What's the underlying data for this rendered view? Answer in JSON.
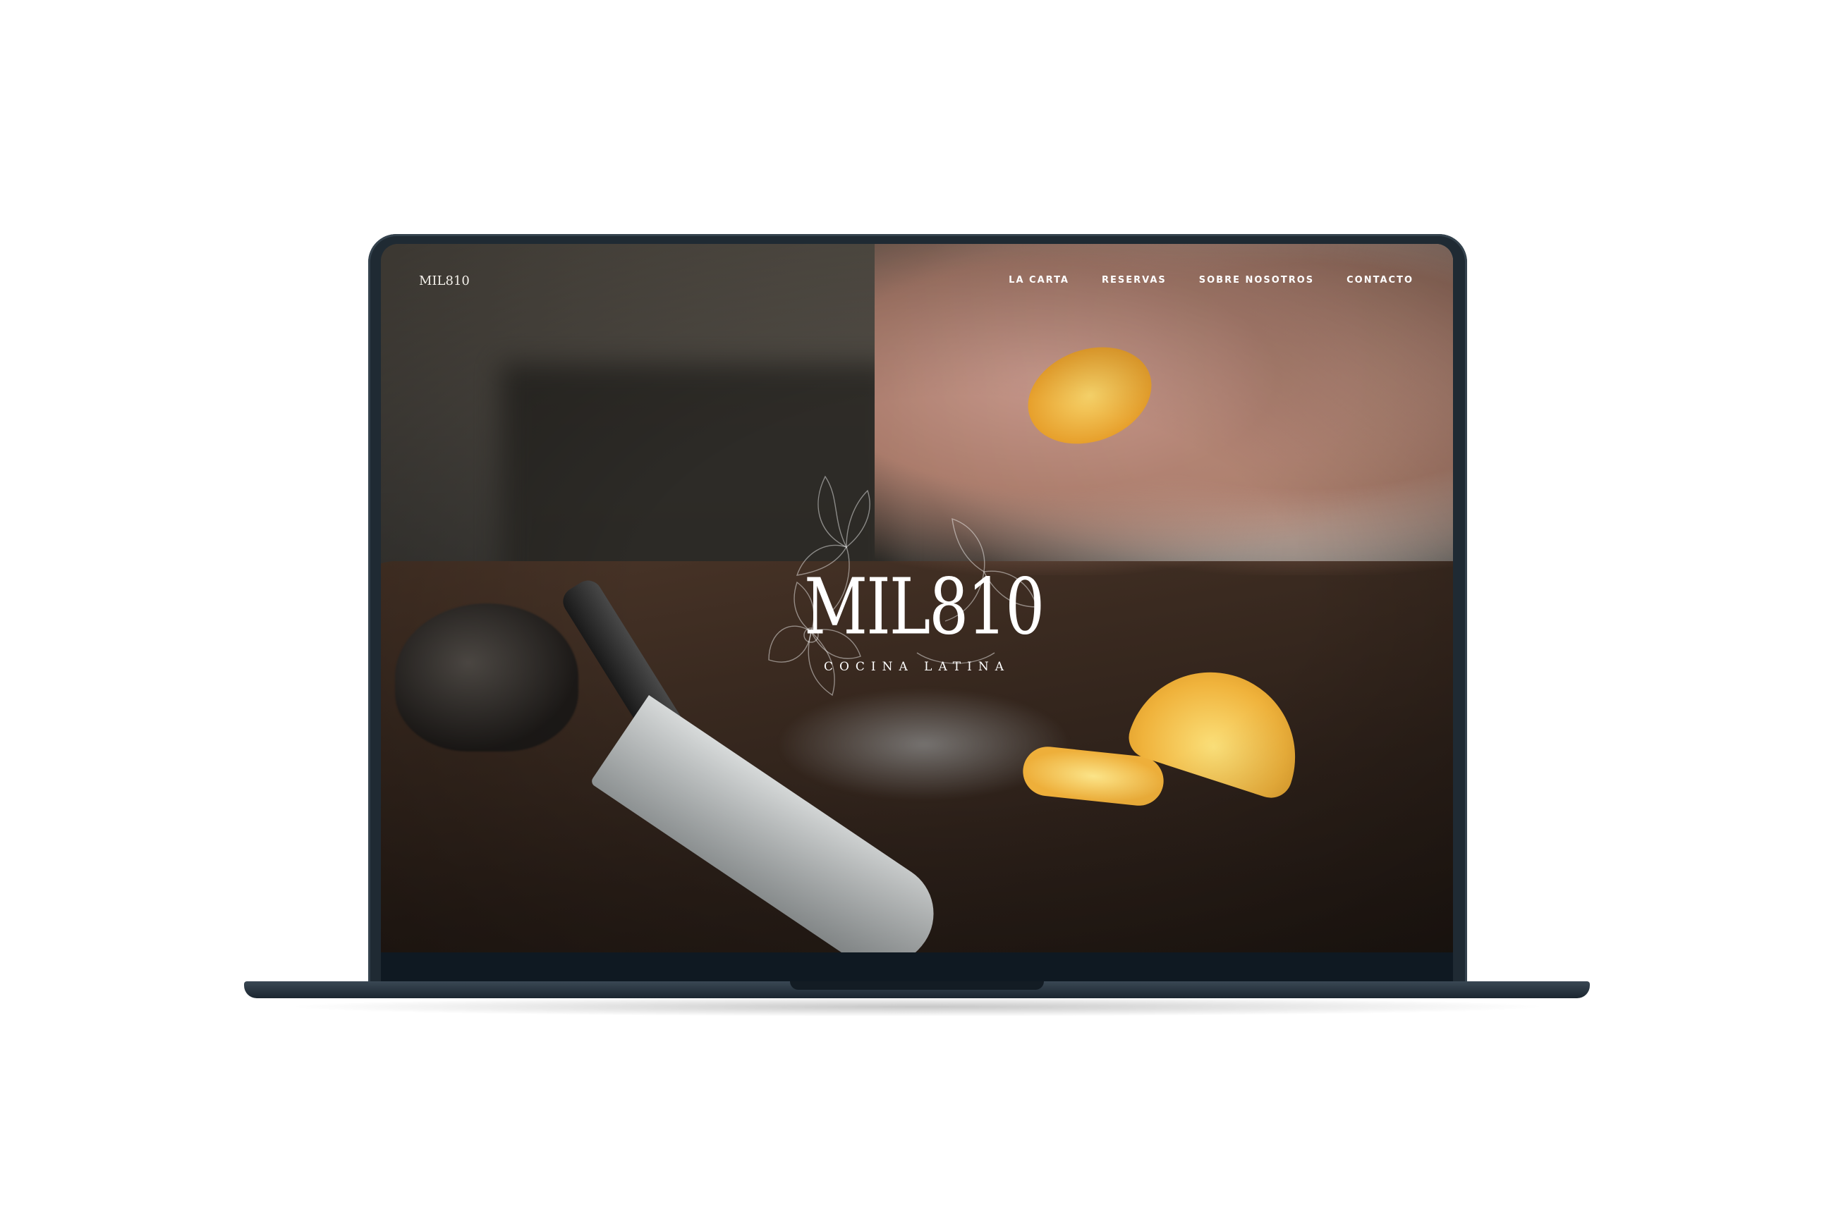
{
  "site": {
    "logo_text": "MIL810",
    "nav": {
      "items": [
        {
          "label": "LA CARTA"
        },
        {
          "label": "RESERVAS"
        },
        {
          "label": "SOBRE NOSOTROS"
        },
        {
          "label": "CONTACTO"
        }
      ]
    },
    "hero": {
      "brand_name": "MIL810",
      "tagline": "COCINA LATINA"
    }
  },
  "colors": {
    "laptop_frame": "#1f2a33",
    "nav_text": "#ffffff",
    "lemon": "#f0b33c"
  }
}
